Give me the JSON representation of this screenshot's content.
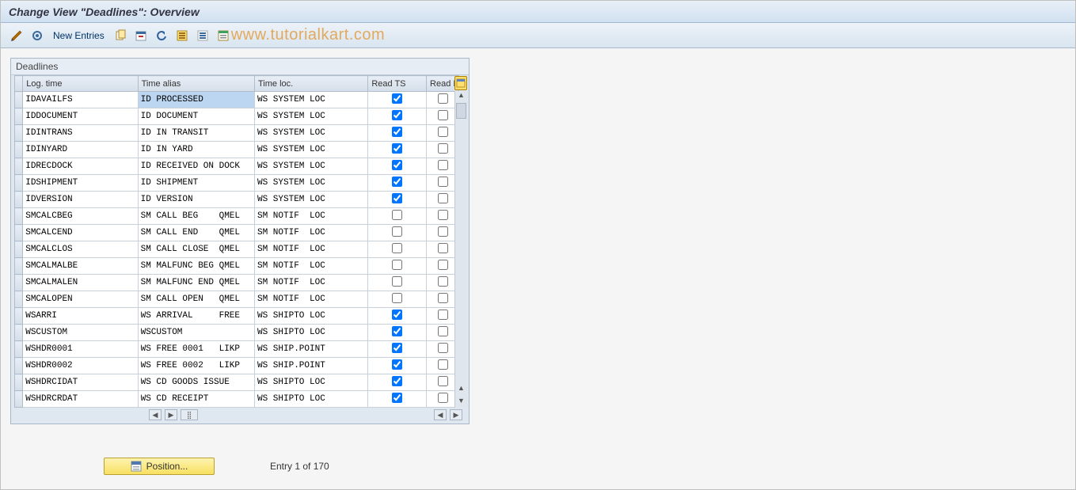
{
  "title": "Change View \"Deadlines\": Overview",
  "toolbar": {
    "new_entries": "New Entries"
  },
  "watermark": "www.tutorialkart.com",
  "panel": {
    "title": "Deadlines",
    "columns": {
      "logtime": "Log. time",
      "alias": "Time alias",
      "loc": "Time loc.",
      "readts": "Read TS",
      "readi": "Read I"
    }
  },
  "rows": [
    {
      "logtime": "IDAVAILFS",
      "alias": "ID PROCESSED",
      "loc": "WS SYSTEM LOC",
      "readts": true,
      "readi": false,
      "sel": true
    },
    {
      "logtime": "IDDOCUMENT",
      "alias": "ID DOCUMENT",
      "loc": "WS SYSTEM LOC",
      "readts": true,
      "readi": false
    },
    {
      "logtime": "IDINTRANS",
      "alias": "ID IN TRANSIT",
      "loc": "WS SYSTEM LOC",
      "readts": true,
      "readi": false
    },
    {
      "logtime": "IDINYARD",
      "alias": "ID IN YARD",
      "loc": "WS SYSTEM LOC",
      "readts": true,
      "readi": false
    },
    {
      "logtime": "IDRECDOCK",
      "alias": "ID RECEIVED ON DOCK",
      "loc": "WS SYSTEM LOC",
      "readts": true,
      "readi": false
    },
    {
      "logtime": "IDSHIPMENT",
      "alias": "ID SHIPMENT",
      "loc": "WS SYSTEM LOC",
      "readts": true,
      "readi": false
    },
    {
      "logtime": "IDVERSION",
      "alias": "ID VERSION",
      "loc": "WS SYSTEM LOC",
      "readts": true,
      "readi": false
    },
    {
      "logtime": "SMCALCBEG",
      "alias": "SM CALL BEG    QMEL",
      "loc": "SM NOTIF  LOC",
      "readts": false,
      "readi": false
    },
    {
      "logtime": "SMCALCEND",
      "alias": "SM CALL END    QMEL",
      "loc": "SM NOTIF  LOC",
      "readts": false,
      "readi": false
    },
    {
      "logtime": "SMCALCLOS",
      "alias": "SM CALL CLOSE  QMEL",
      "loc": "SM NOTIF  LOC",
      "readts": false,
      "readi": false
    },
    {
      "logtime": "SMCALMALBE",
      "alias": "SM MALFUNC BEG QMEL",
      "loc": "SM NOTIF  LOC",
      "readts": false,
      "readi": false
    },
    {
      "logtime": "SMCALMALEN",
      "alias": "SM MALFUNC END QMEL",
      "loc": "SM NOTIF  LOC",
      "readts": false,
      "readi": false
    },
    {
      "logtime": "SMCALOPEN",
      "alias": "SM CALL OPEN   QMEL",
      "loc": "SM NOTIF  LOC",
      "readts": false,
      "readi": false
    },
    {
      "logtime": "WSARRI",
      "alias": "WS ARRIVAL     FREE",
      "loc": "WS SHIPTO LOC",
      "readts": true,
      "readi": false
    },
    {
      "logtime": "WSCUSTOM",
      "alias": "WSCUSTOM",
      "loc": "WS SHIPTO LOC",
      "readts": true,
      "readi": false
    },
    {
      "logtime": "WSHDR0001",
      "alias": "WS FREE 0001   LIKP",
      "loc": "WS SHIP.POINT",
      "readts": true,
      "readi": false
    },
    {
      "logtime": "WSHDR0002",
      "alias": "WS FREE 0002   LIKP",
      "loc": "WS SHIP.POINT",
      "readts": true,
      "readi": false
    },
    {
      "logtime": "WSHDRCIDAT",
      "alias": "WS CD GOODS ISSUE",
      "loc": "WS SHIPTO LOC",
      "readts": true,
      "readi": false
    },
    {
      "logtime": "WSHDRCRDAT",
      "alias": "WS CD RECEIPT",
      "loc": "WS SHIPTO LOC",
      "readts": true,
      "readi": false
    }
  ],
  "footer": {
    "position_btn": "Position...",
    "entry_text": "Entry 1 of 170"
  }
}
